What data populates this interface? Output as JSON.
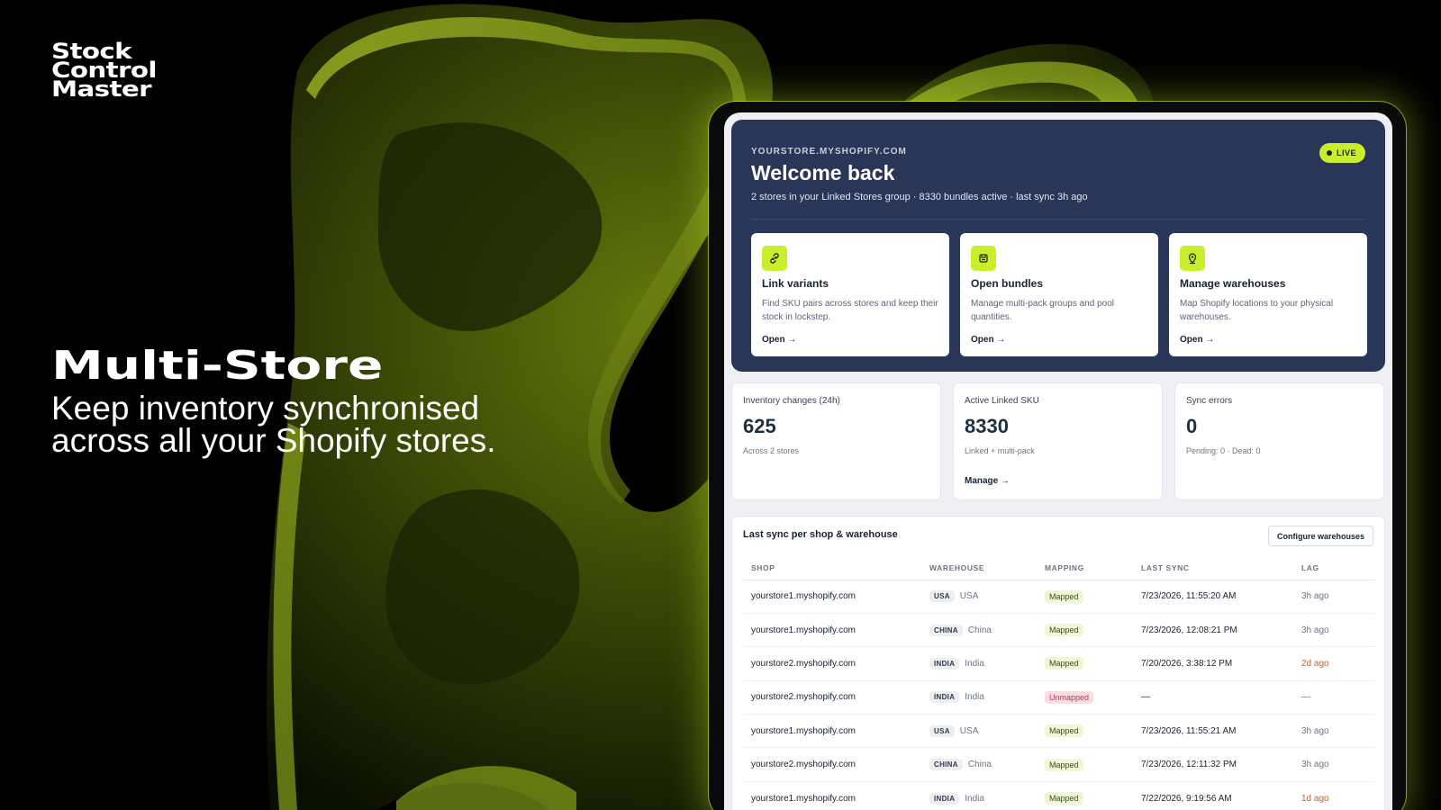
{
  "brand": {
    "line1": "Stock",
    "line2": "Control",
    "line3": "Master"
  },
  "hero": {
    "title": "Multi-Store",
    "subtitle": "Keep inventory synchronised across all your Shopify stores."
  },
  "colors": {
    "accent": "#c8ee2c",
    "panel": "#2a3658",
    "warn": "#d8581c"
  },
  "app": {
    "store_domain": "YOURSTORE.MYSHOPIFY.COM",
    "live_label": "LIVE",
    "welcome": "Welcome back",
    "summary": "2 stores in your Linked Stores group · 8330 bundles active · last sync 3h ago",
    "actions": [
      {
        "icon": "link-icon",
        "title": "Link variants",
        "desc": "Find SKU pairs across stores and keep their stock in lockstep.",
        "link": "Open →"
      },
      {
        "icon": "bundle-icon",
        "title": "Open bundles",
        "desc": "Manage multi-pack groups and pool quantities.",
        "link": "Open →"
      },
      {
        "icon": "location-pin-icon",
        "title": "Manage warehouses",
        "desc": "Map Shopify locations to your physical warehouses.",
        "link": "Open →"
      }
    ],
    "stats": [
      {
        "label": "Inventory changes (24h)",
        "value": "625",
        "note": "Across 2 stores",
        "link": ""
      },
      {
        "label": "Active Linked SKU",
        "value": "8330",
        "note": "Linked + multi-pack",
        "link": "Manage →"
      },
      {
        "label": "Sync errors",
        "value": "0",
        "note": "Pending: 0 · Dead: 0",
        "link": ""
      }
    ],
    "table": {
      "title": "Last sync per shop & warehouse",
      "config_button": "Configure warehouses",
      "headers": [
        "SHOP",
        "WAREHOUSE",
        "MAPPING",
        "LAST SYNC",
        "LAG"
      ],
      "rows": [
        {
          "shop": "yourstore1.myshopify.com",
          "code": "USA",
          "warehouse": "USA",
          "mapping": "Mapped",
          "mapped": true,
          "last_sync": "7/23/2026, 11:55:20 AM",
          "lag": "3h ago",
          "lag_warn": false
        },
        {
          "shop": "yourstore1.myshopify.com",
          "code": "CHINA",
          "warehouse": "China",
          "mapping": "Mapped",
          "mapped": true,
          "last_sync": "7/23/2026, 12:08:21 PM",
          "lag": "3h ago",
          "lag_warn": false
        },
        {
          "shop": "yourstore2.myshopify.com",
          "code": "INDIA",
          "warehouse": "India",
          "mapping": "Mapped",
          "mapped": true,
          "last_sync": "7/20/2026, 3:38:12 PM",
          "lag": "2d ago",
          "lag_warn": true
        },
        {
          "shop": "yourstore2.myshopify.com",
          "code": "INDIA",
          "warehouse": "India",
          "mapping": "Unmapped",
          "mapped": false,
          "last_sync": "—",
          "lag": "—",
          "lag_warn": false
        },
        {
          "shop": "yourstore1.myshopify.com",
          "code": "USA",
          "warehouse": "USA",
          "mapping": "Mapped",
          "mapped": true,
          "last_sync": "7/23/2026, 11:55:21 AM",
          "lag": "3h ago",
          "lag_warn": false
        },
        {
          "shop": "yourstore2.myshopify.com",
          "code": "CHINA",
          "warehouse": "China",
          "mapping": "Mapped",
          "mapped": true,
          "last_sync": "7/23/2026, 12:11:32 PM",
          "lag": "3h ago",
          "lag_warn": false
        },
        {
          "shop": "yourstore1.myshopify.com",
          "code": "INDIA",
          "warehouse": "India",
          "mapping": "Mapped",
          "mapped": true,
          "last_sync": "7/22/2026, 9:19:56 AM",
          "lag": "1d ago",
          "lag_warn": true
        }
      ]
    }
  }
}
